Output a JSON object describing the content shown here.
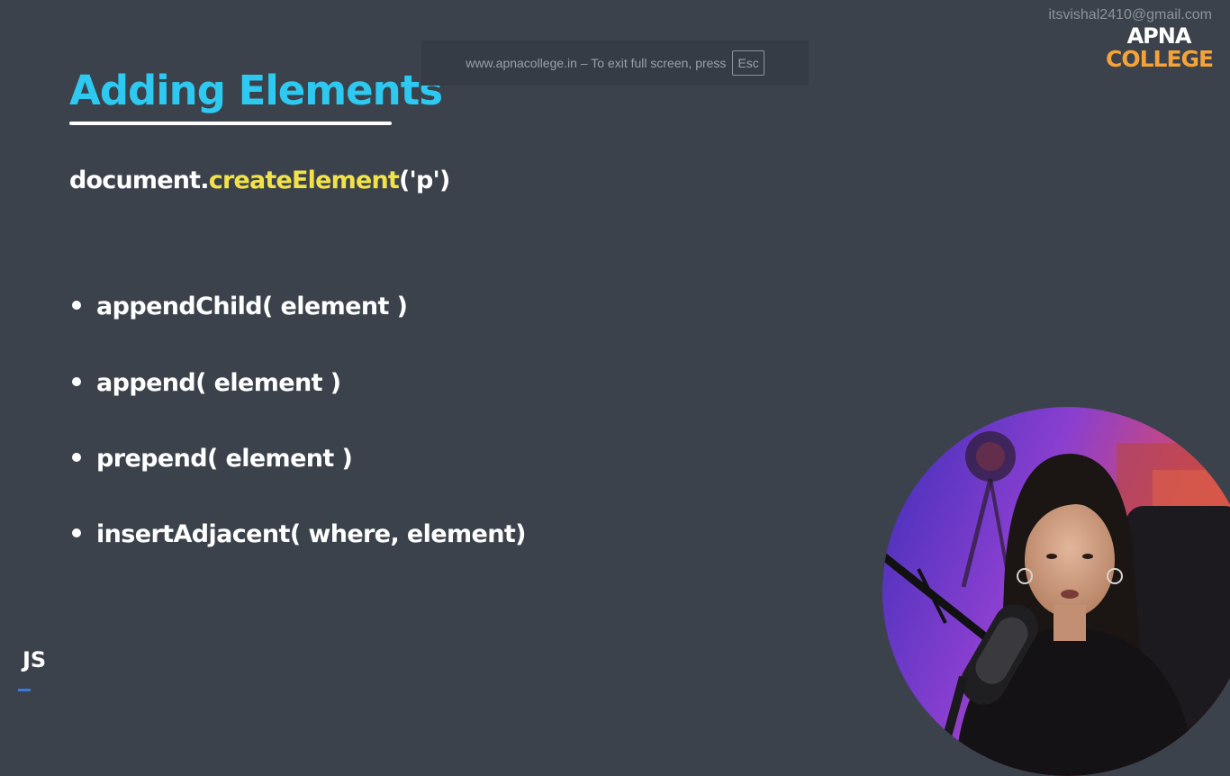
{
  "slide": {
    "title": "Adding Elements",
    "code": {
      "prefix": "document.",
      "method": "createElement",
      "args": "('p')"
    },
    "bullets": [
      "appendChild( element )",
      "append( element )",
      "prepend( element )",
      "insertAdjacent( where,  element)"
    ],
    "footer_label": "JS"
  },
  "fullscreen_notice": {
    "text": "www.apnacollege.in – To exit full screen, press",
    "key": "Esc"
  },
  "watermark": {
    "email": "itsvishal2410@gmail.com",
    "logo_line1": "APNA",
    "logo_line2": "COLLEGE"
  },
  "colors": {
    "background": "#3b424b",
    "title": "#2ec9f0",
    "method_highlight": "#f2e24a",
    "logo_accent": "#f4a33a"
  }
}
